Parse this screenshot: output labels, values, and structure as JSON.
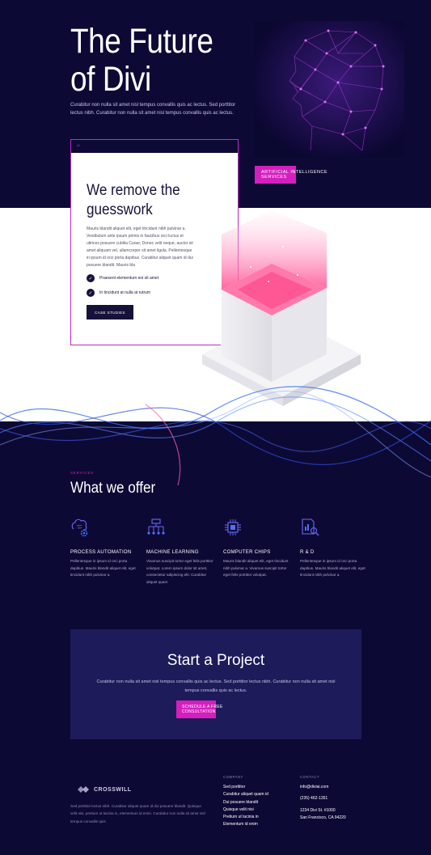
{
  "hero": {
    "title_line1": "The Future",
    "title_line2": "of Divi",
    "subtitle": "Curabitur non nulla sit amet nisl tempus convallis quis ac lectus. Sed porttitor lectus nibh. Curabitur non nulla sit amet nisl tempus convallis quis ac lectus.",
    "ai_button": "ARTIFICIAL INTELLIGENCE SERVICES"
  },
  "card": {
    "top_label": "AI",
    "title": "We remove the guesswork",
    "body": "Mauris blandit aliquet elit, eget tincidunt nibh pulvinar a. Vestibulum ante ipsum primis in faucibus orci luctus et ultrices posuere cubilia Curae; Donec velit neque, auctor sit amet aliquam vel, ullamcorper sit amet ligula. Pellentesque in ipsum id orci porta dapibus. Curabitur aliquet quam id dui posuere blandit. Mauris bla",
    "checks": [
      "Praesent elementum est sit amet",
      "In tincidunt at nulla at rutrum"
    ],
    "button": "CASE STUDIES"
  },
  "services": {
    "label": "SERVICES",
    "title": "What we offer",
    "items": [
      {
        "icon": "brain-gear-icon",
        "name": "PROCESS AUTOMATION",
        "desc": "Pellentesque in ipsum id orci porta dapibus. Mauris blandit aliquet elit, eget tincidunt nibh pulvinar a."
      },
      {
        "icon": "network-icon",
        "name": "MACHINE LEARNING",
        "desc": "Vivamus suscipit tortor eget felis porttitor volutpat. Lorem ipsum dolor sit amet, consectetur adipiscing elit. Curabitur aliquet quam"
      },
      {
        "icon": "chip-icon",
        "name": "COMPUTER CHIPS",
        "desc": "Mauris blandit aliquet elit, eget tincidunt nibh pulvinar a. Vivamus suscipit tortor eget felis porttitor volutpat."
      },
      {
        "icon": "research-icon",
        "name": "R & D",
        "desc": "Pellentesque in ipsum id orci porta dapibus. Mauris blandit aliquet elit, eget tincidunt nibh pulvinar a."
      }
    ]
  },
  "project": {
    "title": "Start a Project",
    "text": "Curabitur non nulla sit amet nisl tempus convallis quis ac lectus. Sed porttitor lectus nibh. Curabitur non nulla sit amet nisl tempus convallis quis ac lectus.",
    "button": "SCHEDULE A FREE CONSULTATION"
  },
  "footer": {
    "logo": "CROSSWILL",
    "text": "Sed porttitor lectus nibh. Curabitur aliquet quam id dui posuere blandit. Quisque velit nisi, pretium ut lacinia in, elementum id enim. Curabitur non nulla sit amet nisl tempus convallis quis",
    "company_heading": "COMPANY",
    "company_links": [
      "Sed porttitor",
      "Curabitur aliquet quam id",
      "Dui posuere blandit",
      "Quisque velit nisi",
      "Pretium ut lacinia in",
      "Elementum id enim"
    ],
    "contact_heading": "CONTACT",
    "email": "info@diviai.com",
    "phone": "(235) 462-1351",
    "address_line1": "1234 Divi St. #1000",
    "address_line2": "San Francisco, CA 94220"
  },
  "colors": {
    "background": "#0d0935",
    "accent": "#d41fbe",
    "panel": "#1d1b59"
  }
}
